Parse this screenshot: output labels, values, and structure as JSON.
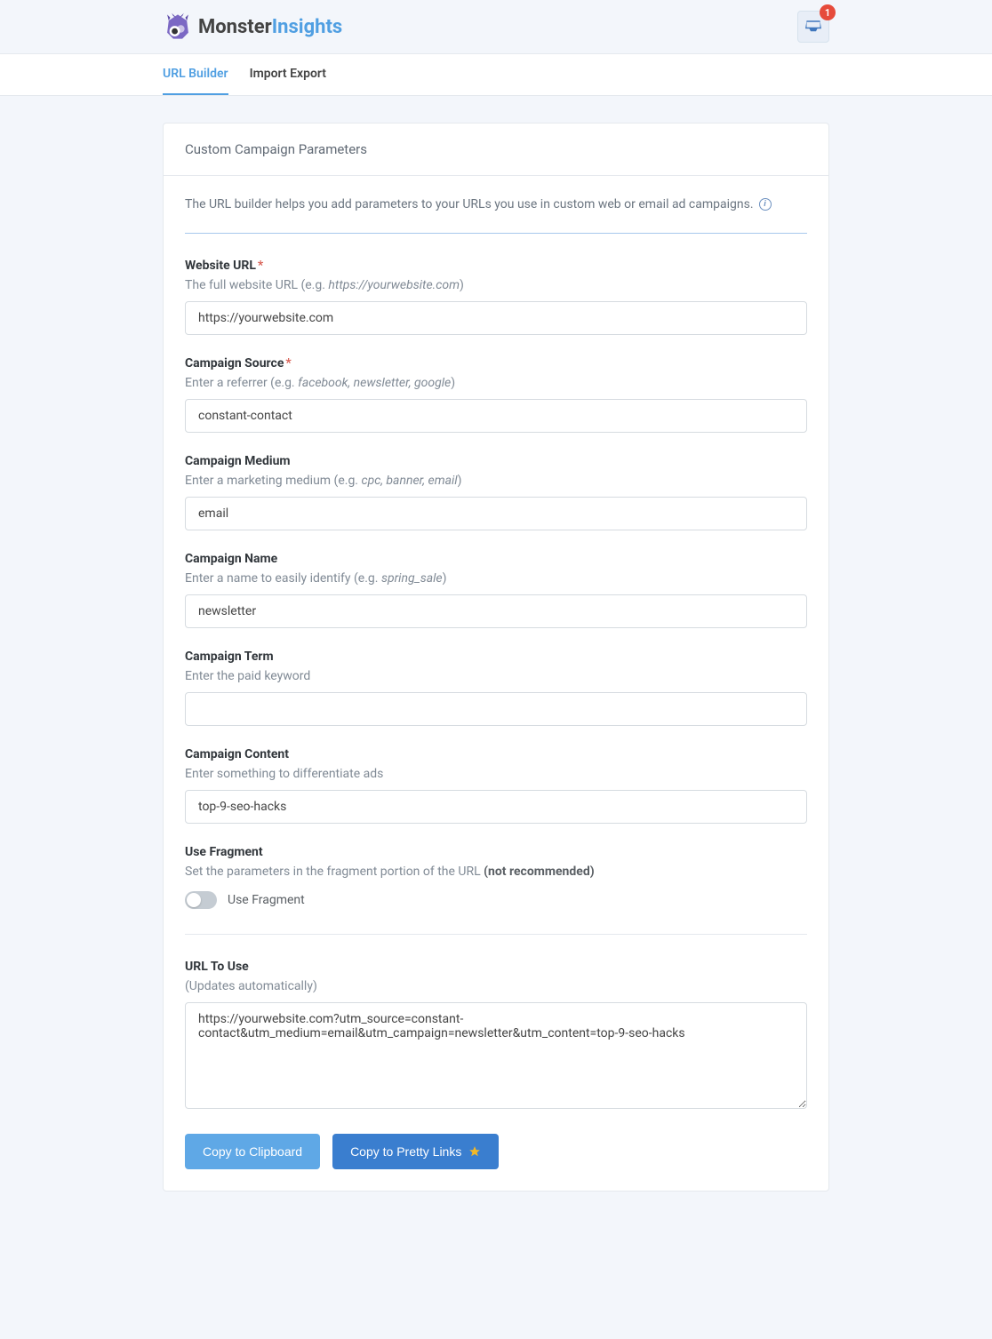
{
  "header": {
    "logo_monster": "Monster",
    "logo_insights": "Insights",
    "inbox_badge": "1"
  },
  "nav": {
    "tabs": [
      {
        "label": "URL Builder",
        "active": true
      },
      {
        "label": "Import Export",
        "active": false
      }
    ]
  },
  "panel": {
    "title": "Custom Campaign Parameters",
    "intro": "The URL builder helps you add parameters to your URLs you use in custom web or email ad campaigns."
  },
  "fields": {
    "website_url": {
      "label": "Website URL",
      "required": "*",
      "hint_pre": "The full website URL (e.g. ",
      "hint_em": "https://yourwebsite.com",
      "hint_post": ")",
      "value": "https://yourwebsite.com"
    },
    "campaign_source": {
      "label": "Campaign Source",
      "required": "*",
      "hint_pre": "Enter a referrer (e.g. ",
      "hint_em": "facebook, newsletter, google",
      "hint_post": ")",
      "value": "constant-contact"
    },
    "campaign_medium": {
      "label": "Campaign Medium",
      "hint_pre": "Enter a marketing medium (e.g. ",
      "hint_em": "cpc, banner, email",
      "hint_post": ")",
      "value": "email"
    },
    "campaign_name": {
      "label": "Campaign Name",
      "hint_pre": "Enter a name to easily identify (e.g. ",
      "hint_em": "spring_sale",
      "hint_post": ")",
      "value": "newsletter"
    },
    "campaign_term": {
      "label": "Campaign Term",
      "hint": "Enter the paid keyword",
      "value": ""
    },
    "campaign_content": {
      "label": "Campaign Content",
      "hint": "Enter something to differentiate ads",
      "value": "top-9-seo-hacks"
    },
    "use_fragment": {
      "label": "Use Fragment",
      "hint_pre": "Set the parameters in the fragment portion of the URL ",
      "hint_strong": "(not recommended)",
      "toggle_label": "Use Fragment"
    },
    "url_to_use": {
      "label": "URL To Use",
      "hint": "(Updates automatically)",
      "value": "https://yourwebsite.com?utm_source=constant-contact&utm_medium=email&utm_campaign=newsletter&utm_content=top-9-seo-hacks"
    }
  },
  "buttons": {
    "copy_clipboard": "Copy to Clipboard",
    "copy_pretty": "Copy to Pretty Links"
  }
}
